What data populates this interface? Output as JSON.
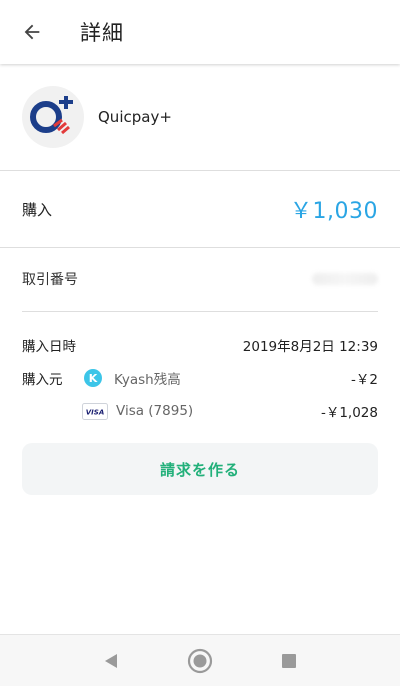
{
  "appbar": {
    "title": "詳細",
    "back_icon": "arrow-left-icon"
  },
  "merchant": {
    "name": "Quicpay+",
    "logo_icon": "quicpay-logo-icon"
  },
  "purchase": {
    "label": "購入",
    "amount": "￥1,030",
    "amount_color": "#2aa5e4"
  },
  "transaction": {
    "label": "取引番号"
  },
  "details": {
    "datetime_label": "購入日時",
    "datetime_value": "2019年8月2日 12:39",
    "source_label": "購入元",
    "sources": [
      {
        "name": "Kyash残高",
        "amount": "-￥2",
        "icon": "kyash-icon"
      },
      {
        "name": "Visa (7895)",
        "amount": "-￥1,028",
        "icon": "visa-card-icon"
      }
    ]
  },
  "request_button": {
    "label": "請求を作る",
    "color": "#22b07a"
  },
  "navbar": {
    "back_icon": "triangle-back-icon",
    "home_icon": "circle-home-icon",
    "recents_icon": "square-recents-icon"
  }
}
